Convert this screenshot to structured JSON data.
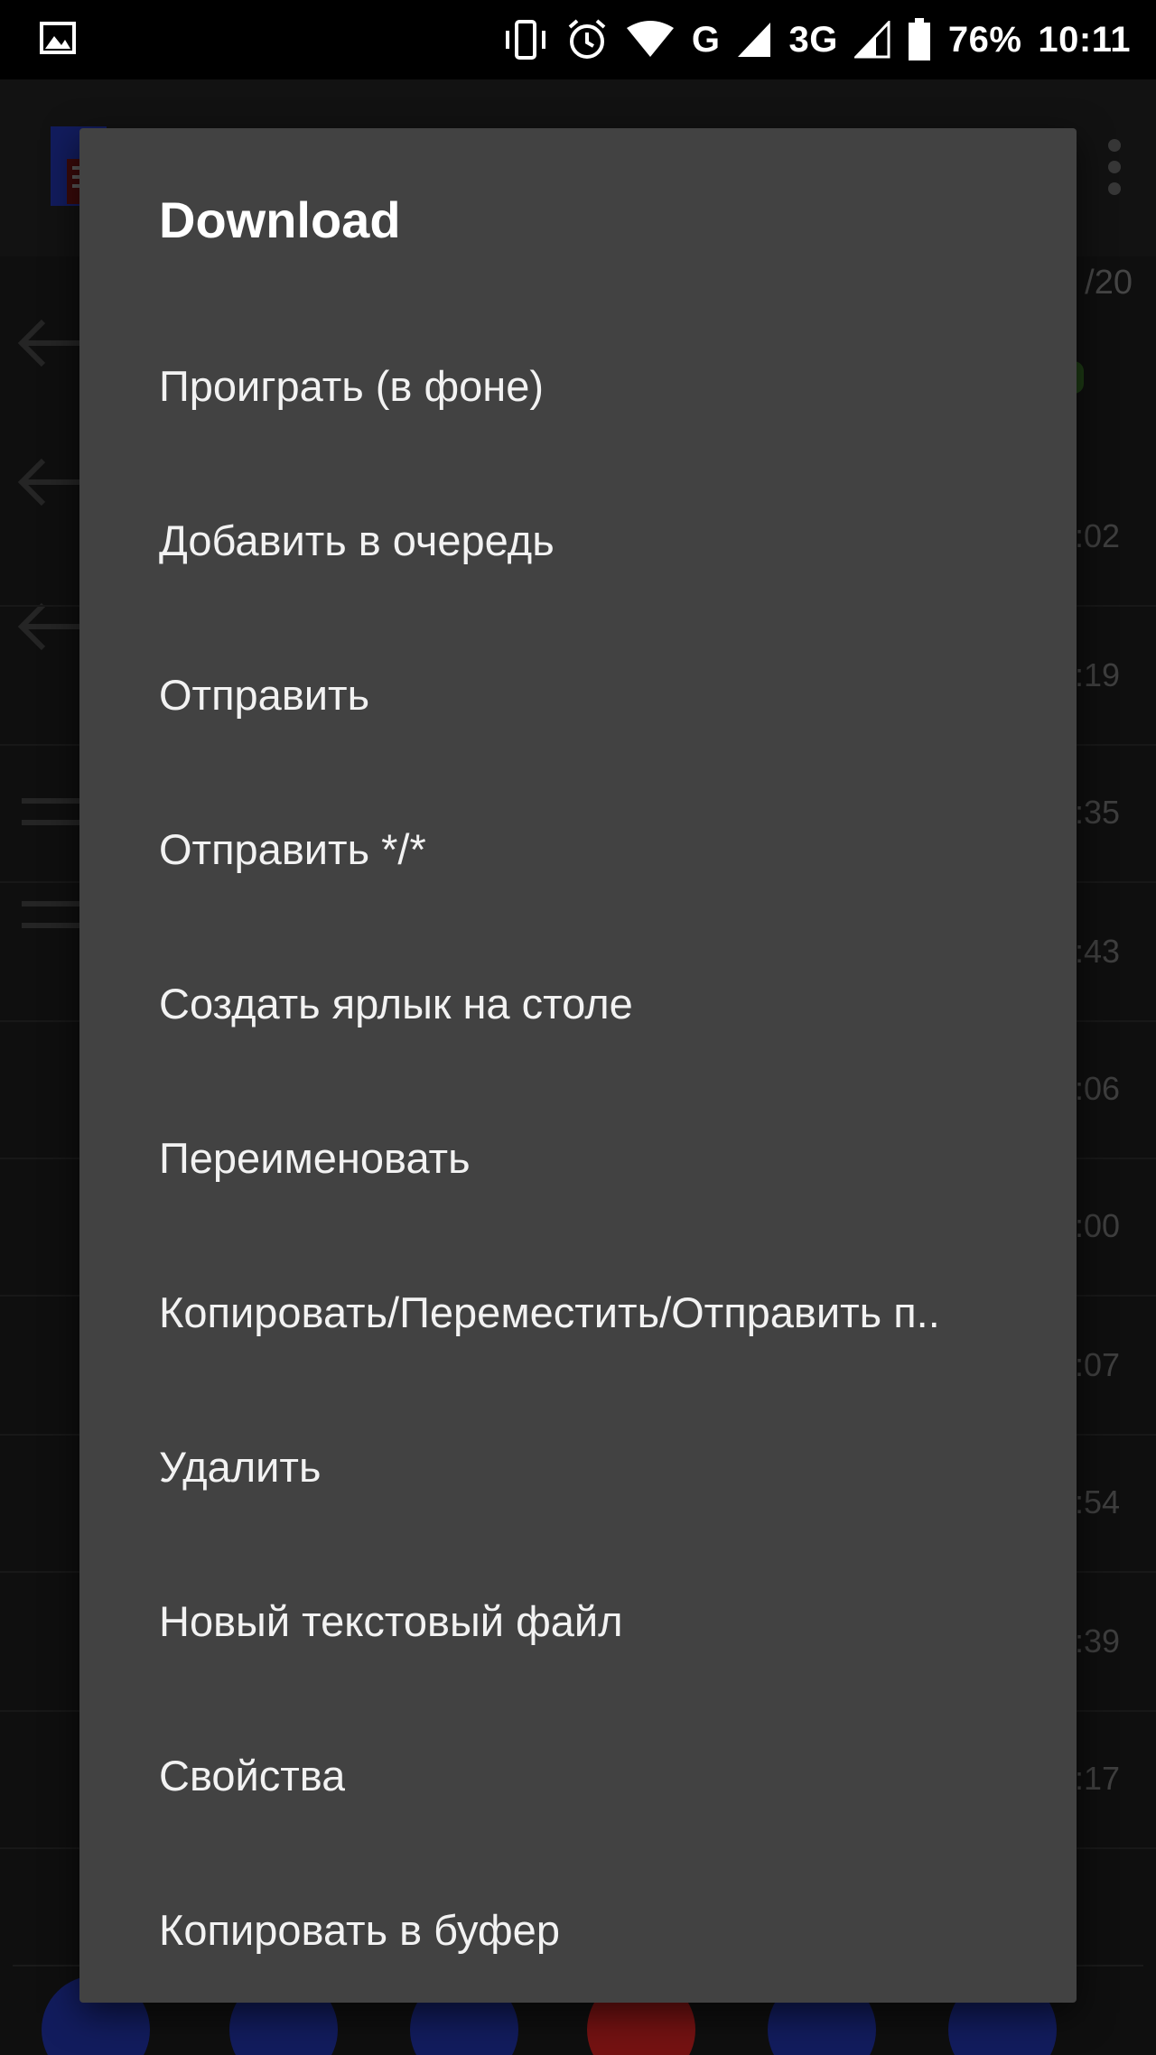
{
  "status_bar": {
    "battery_percent": "76%",
    "time": "10:11",
    "network_g": "G",
    "network_3g": "3G",
    "icons": [
      "image-icon",
      "vibrate-icon",
      "alarm-icon",
      "wifi-icon",
      "signal-icon",
      "signal-icon",
      "battery-icon"
    ]
  },
  "background": {
    "count_label": "/20",
    "row_times": [
      ":02",
      ":19",
      ":35",
      ":43",
      ":06",
      ":00",
      ":07",
      ":54",
      ":39",
      ":17"
    ],
    "colors": {
      "accent_blue": "#1d2b8f",
      "accent_red": "#b21d1d",
      "status_green": "#2d5a1f"
    }
  },
  "dialog": {
    "title": "Download",
    "items": [
      {
        "label": "Проиграть (в фоне)"
      },
      {
        "label": "Добавить в очередь"
      },
      {
        "label": "Отправить"
      },
      {
        "label": "Отправить */*"
      },
      {
        "label": "Создать ярлык на столе"
      },
      {
        "label": "Переименовать"
      },
      {
        "label": "Копировать/Переместить/Отправить п.."
      },
      {
        "label": "Удалить"
      },
      {
        "label": "Новый текстовый файл"
      },
      {
        "label": "Свойства"
      },
      {
        "label": "Копировать в буфер"
      }
    ]
  }
}
